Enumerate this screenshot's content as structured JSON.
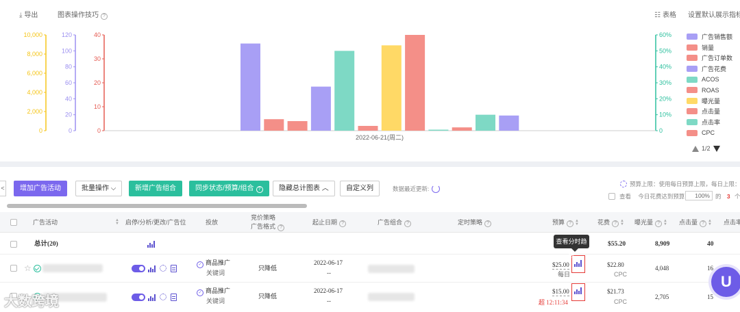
{
  "toolbar": {
    "export_label": "导出",
    "chart_tips_label": "图表操作技巧",
    "table_view_label": "表格",
    "default_display_label": "设置默认展示指标"
  },
  "chart_data": {
    "type": "bar",
    "x_label": "2022-06-21(周二)",
    "series": [
      {
        "name": "广告销售额",
        "color": "#a89ff5",
        "axis": "y1",
        "value": 9100
      },
      {
        "name": "销量",
        "color": "#f48f88",
        "axis": "y3",
        "value": 4.8
      },
      {
        "name": "广告订单数",
        "color": "#f48f88",
        "axis": "y3",
        "value": 4
      },
      {
        "name": "广告花费",
        "color": "#a89ff5",
        "axis": "y2",
        "value": 55.2
      },
      {
        "name": "ACOS",
        "color": "#7ed9c5",
        "axis": "y4",
        "value": 0.5
      },
      {
        "name": "ROAS",
        "color": "#f48f88",
        "axis": "y3",
        "value": 2
      },
      {
        "name": "曝光量",
        "color": "#ffd966",
        "axis": "y1",
        "value": 8909
      },
      {
        "name": "点击量",
        "color": "#f48f88",
        "axis": "y3",
        "value": 40
      },
      {
        "name": "点击率",
        "color": "#7ed9c5",
        "axis": "y4",
        "value": 0.004
      },
      {
        "name": "CPC",
        "color": "#f48f88",
        "axis": "y3",
        "value": 1.38
      },
      {
        "name": "",
        "color": "#7ed9c5",
        "axis": "y4",
        "value": 0.1
      },
      {
        "name": "",
        "color": "#a89ff5",
        "axis": "y2",
        "value": 19
      }
    ],
    "axes": {
      "y1": {
        "color": "#f5c518",
        "ticks": [
          "0",
          "2,000",
          "4,000",
          "6,000",
          "8,000",
          "10,000"
        ],
        "max": 10000
      },
      "y2": {
        "color": "#9b8ff0",
        "ticks": [
          "0",
          "20",
          "40",
          "60",
          "80",
          "100",
          "120"
        ],
        "max": 120
      },
      "y3": {
        "color": "#e55b52",
        "ticks": [
          "0",
          "10",
          "20",
          "30",
          "40"
        ],
        "max": 40
      },
      "y4": {
        "color": "#2bbf9d",
        "ticks": [
          "0",
          "10%",
          "20%",
          "30%",
          "40%",
          "50%",
          "60%"
        ],
        "max": 0.6
      }
    },
    "legend": [
      {
        "name": "广告销售额",
        "color": "#a89ff5"
      },
      {
        "name": "销量",
        "color": "#f48f88"
      },
      {
        "name": "广告订单数",
        "color": "#f48f88"
      },
      {
        "name": "广告花费",
        "color": "#a89ff5"
      },
      {
        "name": "ACOS",
        "color": "#7ed9c5"
      },
      {
        "name": "ROAS",
        "color": "#f48f88"
      },
      {
        "name": "曝光量",
        "color": "#ffd966"
      },
      {
        "name": "点击量",
        "color": "#f48f88"
      },
      {
        "name": "点击率",
        "color": "#7ed9c5"
      },
      {
        "name": "CPC",
        "color": "#f48f88"
      }
    ],
    "legend_page": "1/2"
  },
  "actions": {
    "edge_tab": "<",
    "add_campaign": "增加广告活动",
    "bulk_ops": "批量操作",
    "new_ad_group": "新增广告组合",
    "sync_status": "同步状态/预算/组合",
    "hide_total_chart": "隐藏总计图表",
    "custom_columns": "自定义列",
    "last_update_label": "数据最近更新:",
    "budget_cap_note": "预算上限：使用每日预算上限，每日上限：",
    "view_label": "查看",
    "today_spend_label": "今日花费达到预算",
    "pct_value": "100%",
    "of_label": "的",
    "count_value": "3",
    "count_unit": "个"
  },
  "table": {
    "headers": {
      "campaign": "广告活动",
      "enable": "启停/分析/更改/广告位",
      "delivery": "投放",
      "bid_strategy": "竞价策略",
      "ad_format": "广告格式",
      "start_date": "起止日期",
      "ad_group": "广告组合",
      "schedule": "定时策略",
      "budget": "预算",
      "spend": "花费",
      "impressions": "曝光量",
      "clicks": "点击量",
      "ctr": "点击率"
    },
    "total": {
      "label": "总计(20)",
      "spend": "$55.20",
      "impressions": "8,909",
      "clicks": "40"
    },
    "rows": [
      {
        "delivery_type": "商品推广",
        "delivery_sub": "关键词",
        "bid_strategy": "只降低",
        "start_date": "2022-06-17",
        "end_date": "--",
        "budget": "$25.00",
        "budget_period": "每日",
        "budget_over": "",
        "spend": "$22.80",
        "spend_sub": "CPC",
        "impressions": "4,048",
        "clicks": "16"
      },
      {
        "delivery_type": "商品推广",
        "delivery_sub": "关键词",
        "bid_strategy": "只降低",
        "start_date": "2022-06-17",
        "end_date": "--",
        "budget": "$15.00",
        "budget_period": "",
        "budget_over": "超 12:11:34",
        "spend": "$21.73",
        "spend_sub": "CPC",
        "impressions": "2,705",
        "clicks": "15"
      }
    ]
  },
  "tooltip": "查看分时趋势",
  "fab_label": "U",
  "watermark": "大数跨境"
}
